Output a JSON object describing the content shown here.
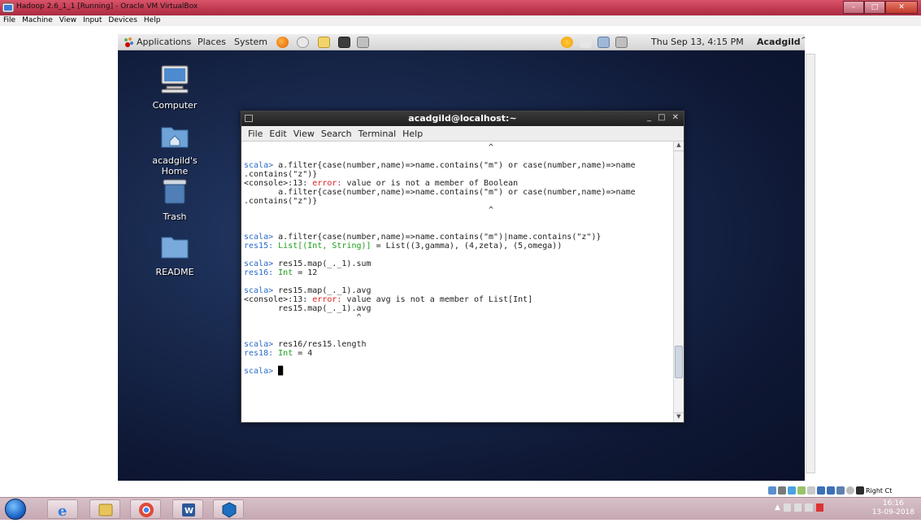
{
  "host_window": {
    "title": "Hadoop 2.6_1_1 [Running] - Oracle VM VirtualBox",
    "menus": [
      "File",
      "Machine",
      "View",
      "Input",
      "Devices",
      "Help"
    ],
    "controls": {
      "minimize": "–",
      "maximize": "□",
      "close": "✕"
    }
  },
  "guest_panel": {
    "menus": [
      "Applications",
      "Places",
      "System"
    ],
    "clock": "Thu Sep 13,  4:15 PM",
    "user": "Acadgild",
    "up_glyph": "^"
  },
  "desktop_icons": [
    {
      "label": "Computer"
    },
    {
      "label": "acadgild's Home"
    },
    {
      "label": "Trash"
    },
    {
      "label": "README"
    }
  ],
  "terminal": {
    "title": "acadgild@localhost:~",
    "window_controls": {
      "minimize": "_",
      "maximize": "□",
      "close": "✕"
    },
    "menus": [
      "File",
      "Edit",
      "View",
      "Search",
      "Terminal",
      "Help"
    ],
    "scroll_position": 0.85
  },
  "taskbar": {
    "time": "16:16",
    "date": "13-09-2018",
    "status_label": "Right Ct"
  },
  "colors": {
    "prompt": "#2a6bc9",
    "error": "#d22222",
    "type": "#1b9c1b",
    "accent_title": "#c23a51"
  }
}
